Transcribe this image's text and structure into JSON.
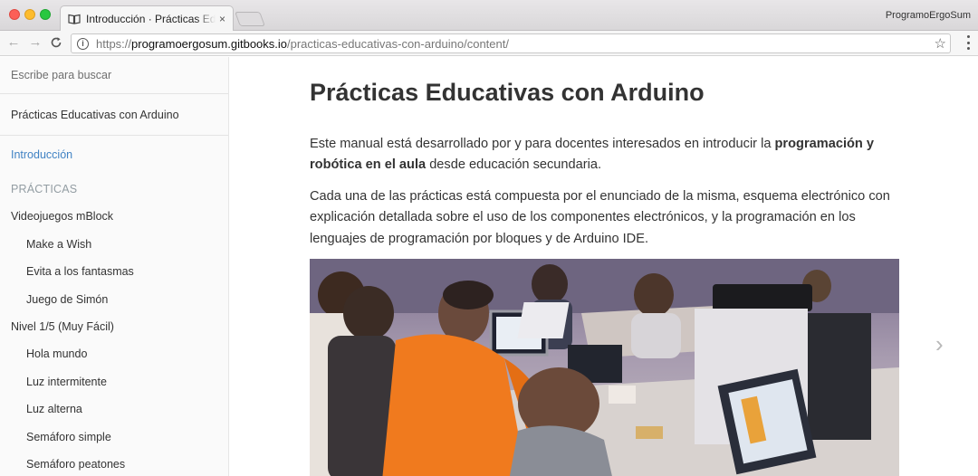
{
  "browser": {
    "tab_title": "Introducción · Prácticas Educativas con Arduino",
    "tab_close": "×",
    "profile": "ProgramoErgoSum",
    "url_scheme": "https://",
    "url_host": "programoergosum.gitbooks.io",
    "url_path": "/practicas-educativas-con-arduino/content/",
    "icons": {
      "back": "back-arrow-icon",
      "forward": "forward-arrow-icon",
      "reload": "reload-icon",
      "info": "info-icon",
      "bookmark": "star-icon",
      "menu": "more-vertical-icon"
    }
  },
  "sidebar": {
    "search_placeholder": "Escribe para buscar",
    "book_title": "Prácticas Educativas con Arduino",
    "active_item": "Introducción",
    "section_header": "PRÁCTICAS",
    "items": [
      {
        "label": "Videojuegos mBlock",
        "level": 1
      },
      {
        "label": "Make a Wish",
        "level": 2
      },
      {
        "label": "Evita a los fantasmas",
        "level": 2
      },
      {
        "label": "Juego de Simón",
        "level": 2
      },
      {
        "label": "Nivel 1/5 (Muy Fácil)",
        "level": 1
      },
      {
        "label": "Hola mundo",
        "level": 2
      },
      {
        "label": "Luz intermitente",
        "level": 2
      },
      {
        "label": "Luz alterna",
        "level": 2
      },
      {
        "label": "Semáforo simple",
        "level": 2
      },
      {
        "label": "Semáforo peatones",
        "level": 2
      }
    ]
  },
  "main": {
    "title": "Prácticas Educativas con Arduino",
    "p1_before": "Este manual está desarrollado por y para docentes interesados en introducir la ",
    "p1_bold": "programación y robótica en el aula",
    "p1_after": " desde educación secundaria.",
    "p2": "Cada una de las prácticas está compuesta por el enunciado de la misma, esquema electrónico con explicación detallada sobre el uso de los componentes electrónicos, y la programación en los lenguajes de programación por bloques y de Arduino IDE.",
    "next_glyph": "›"
  },
  "colors": {
    "link_active": "#4183c4",
    "section_header": "#939da3",
    "text": "#333333"
  }
}
